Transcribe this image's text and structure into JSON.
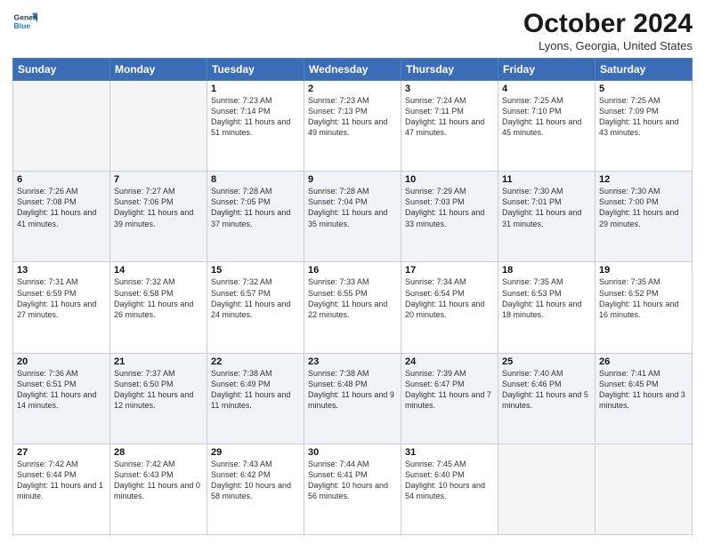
{
  "header": {
    "logo_line1": "General",
    "logo_line2": "Blue",
    "title": "October 2024",
    "subtitle": "Lyons, Georgia, United States"
  },
  "days_of_week": [
    "Sunday",
    "Monday",
    "Tuesday",
    "Wednesday",
    "Thursday",
    "Friday",
    "Saturday"
  ],
  "weeks": [
    [
      {
        "day": "",
        "empty": true
      },
      {
        "day": "",
        "empty": true
      },
      {
        "day": "1",
        "sunrise": "7:23 AM",
        "sunset": "7:14 PM",
        "daylight": "11 hours and 51 minutes."
      },
      {
        "day": "2",
        "sunrise": "7:23 AM",
        "sunset": "7:13 PM",
        "daylight": "11 hours and 49 minutes."
      },
      {
        "day": "3",
        "sunrise": "7:24 AM",
        "sunset": "7:11 PM",
        "daylight": "11 hours and 47 minutes."
      },
      {
        "day": "4",
        "sunrise": "7:25 AM",
        "sunset": "7:10 PM",
        "daylight": "11 hours and 45 minutes."
      },
      {
        "day": "5",
        "sunrise": "7:25 AM",
        "sunset": "7:09 PM",
        "daylight": "11 hours and 43 minutes."
      }
    ],
    [
      {
        "day": "6",
        "sunrise": "7:26 AM",
        "sunset": "7:08 PM",
        "daylight": "11 hours and 41 minutes."
      },
      {
        "day": "7",
        "sunrise": "7:27 AM",
        "sunset": "7:06 PM",
        "daylight": "11 hours and 39 minutes."
      },
      {
        "day": "8",
        "sunrise": "7:28 AM",
        "sunset": "7:05 PM",
        "daylight": "11 hours and 37 minutes."
      },
      {
        "day": "9",
        "sunrise": "7:28 AM",
        "sunset": "7:04 PM",
        "daylight": "11 hours and 35 minutes."
      },
      {
        "day": "10",
        "sunrise": "7:29 AM",
        "sunset": "7:03 PM",
        "daylight": "11 hours and 33 minutes."
      },
      {
        "day": "11",
        "sunrise": "7:30 AM",
        "sunset": "7:01 PM",
        "daylight": "11 hours and 31 minutes."
      },
      {
        "day": "12",
        "sunrise": "7:30 AM",
        "sunset": "7:00 PM",
        "daylight": "11 hours and 29 minutes."
      }
    ],
    [
      {
        "day": "13",
        "sunrise": "7:31 AM",
        "sunset": "6:59 PM",
        "daylight": "11 hours and 27 minutes."
      },
      {
        "day": "14",
        "sunrise": "7:32 AM",
        "sunset": "6:58 PM",
        "daylight": "11 hours and 26 minutes."
      },
      {
        "day": "15",
        "sunrise": "7:32 AM",
        "sunset": "6:57 PM",
        "daylight": "11 hours and 24 minutes."
      },
      {
        "day": "16",
        "sunrise": "7:33 AM",
        "sunset": "6:55 PM",
        "daylight": "11 hours and 22 minutes."
      },
      {
        "day": "17",
        "sunrise": "7:34 AM",
        "sunset": "6:54 PM",
        "daylight": "11 hours and 20 minutes."
      },
      {
        "day": "18",
        "sunrise": "7:35 AM",
        "sunset": "6:53 PM",
        "daylight": "11 hours and 18 minutes."
      },
      {
        "day": "19",
        "sunrise": "7:35 AM",
        "sunset": "6:52 PM",
        "daylight": "11 hours and 16 minutes."
      }
    ],
    [
      {
        "day": "20",
        "sunrise": "7:36 AM",
        "sunset": "6:51 PM",
        "daylight": "11 hours and 14 minutes."
      },
      {
        "day": "21",
        "sunrise": "7:37 AM",
        "sunset": "6:50 PM",
        "daylight": "11 hours and 12 minutes."
      },
      {
        "day": "22",
        "sunrise": "7:38 AM",
        "sunset": "6:49 PM",
        "daylight": "11 hours and 11 minutes."
      },
      {
        "day": "23",
        "sunrise": "7:38 AM",
        "sunset": "6:48 PM",
        "daylight": "11 hours and 9 minutes."
      },
      {
        "day": "24",
        "sunrise": "7:39 AM",
        "sunset": "6:47 PM",
        "daylight": "11 hours and 7 minutes."
      },
      {
        "day": "25",
        "sunrise": "7:40 AM",
        "sunset": "6:46 PM",
        "daylight": "11 hours and 5 minutes."
      },
      {
        "day": "26",
        "sunrise": "7:41 AM",
        "sunset": "6:45 PM",
        "daylight": "11 hours and 3 minutes."
      }
    ],
    [
      {
        "day": "27",
        "sunrise": "7:42 AM",
        "sunset": "6:44 PM",
        "daylight": "11 hours and 1 minute."
      },
      {
        "day": "28",
        "sunrise": "7:42 AM",
        "sunset": "6:43 PM",
        "daylight": "11 hours and 0 minutes."
      },
      {
        "day": "29",
        "sunrise": "7:43 AM",
        "sunset": "6:42 PM",
        "daylight": "10 hours and 58 minutes."
      },
      {
        "day": "30",
        "sunrise": "7:44 AM",
        "sunset": "6:41 PM",
        "daylight": "10 hours and 56 minutes."
      },
      {
        "day": "31",
        "sunrise": "7:45 AM",
        "sunset": "6:40 PM",
        "daylight": "10 hours and 54 minutes."
      },
      {
        "day": "",
        "empty": true
      },
      {
        "day": "",
        "empty": true
      }
    ]
  ]
}
